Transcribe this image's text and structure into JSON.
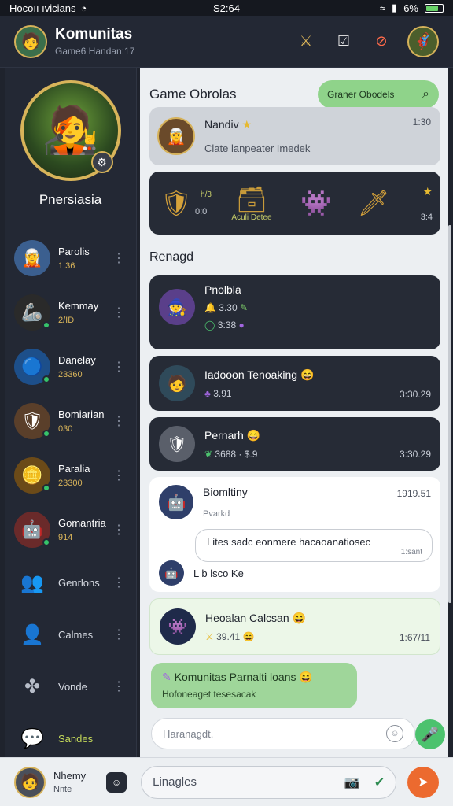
{
  "status": {
    "left_text": "Hocoıı ıvicians",
    "time": "S2:64",
    "battery": "6%"
  },
  "header": {
    "title": "Komunitas",
    "subtitle": "Game6 Handan:17",
    "actions": [
      {
        "icon": "sword-icon",
        "glyph": "⚔"
      },
      {
        "icon": "check-box-icon",
        "glyph": "☑"
      },
      {
        "icon": "no-entry-icon",
        "glyph": "⊘"
      }
    ]
  },
  "sidebar": {
    "profile_name": "Pnersiasia",
    "contacts": [
      {
        "label": "Parolis",
        "sub": "1.36",
        "glyph": "🧝"
      },
      {
        "label": "Kemmay",
        "sub": "2/ID",
        "glyph": "🦾"
      },
      {
        "label": "Danelay",
        "sub": "23360",
        "glyph": "🔵"
      },
      {
        "label": "Bomiarian",
        "sub": "030",
        "glyph": "🛡"
      },
      {
        "label": "Paralia",
        "sub": "23300",
        "glyph": "🪙"
      },
      {
        "label": "Gomantria",
        "sub": "914",
        "glyph": "🤖"
      }
    ],
    "nav": [
      {
        "label": "Genrlons",
        "glyph": "👥",
        "icon": "groups-icon"
      },
      {
        "label": "Calmes",
        "glyph": "👤",
        "icon": "person-icon"
      },
      {
        "label": "Vonde",
        "glyph": "✤",
        "icon": "puzzle-icon"
      },
      {
        "label": "Sandes",
        "glyph": "💬",
        "icon": "chat-bubble-icon"
      }
    ]
  },
  "main": {
    "title": "Game Obrolas",
    "search_pill": "Graner Obodels",
    "card1": {
      "name": "Nandiv",
      "star": "★",
      "message": "Clate lanpeater Imedek",
      "time": "1:30"
    },
    "card2": {
      "items": [
        "🛡",
        "🗃",
        "👾",
        "🗡"
      ],
      "label_left": "h/3",
      "label_left2": "0:0",
      "caption": "Aculi Detee",
      "right_time": "3:4",
      "right_star": "★"
    },
    "section": "Renagd",
    "card3": {
      "name": "Pnolbla",
      "meta1": "3.30",
      "meta2": "3:38"
    },
    "card4": {
      "name": "Iadooon Tenoaking",
      "meta": "3.91",
      "time": "3:30.29"
    },
    "card5": {
      "name": "Pernarh",
      "meta": "3688 · $.9",
      "time": "3:30.29"
    },
    "card6": {
      "name": "Biomltiny",
      "sub": "Pvarkd",
      "time": "1919.51",
      "bubble": "Lites sadc eonmere hacaoanatiosec",
      "bubble_time": "1:sant",
      "footer": "L b lsco Ke"
    },
    "card7": {
      "name": "Heoalan Calcsan",
      "meta": "39.41",
      "time": "1:67/11"
    },
    "card8": {
      "name": "Komunitas Parnalti loans",
      "message": "Hofoneaget tesesacak"
    },
    "composer_placeholder": "Haranagdt."
  },
  "bottom": {
    "user_name": "Nhemy",
    "user_sub": "Nnte",
    "search_placeholder": "Linagles"
  },
  "colors": {
    "accent_green": "#4cc26e",
    "gold": "#d8b45a",
    "orange": "#ec6a2f",
    "dark": "#262b36"
  }
}
